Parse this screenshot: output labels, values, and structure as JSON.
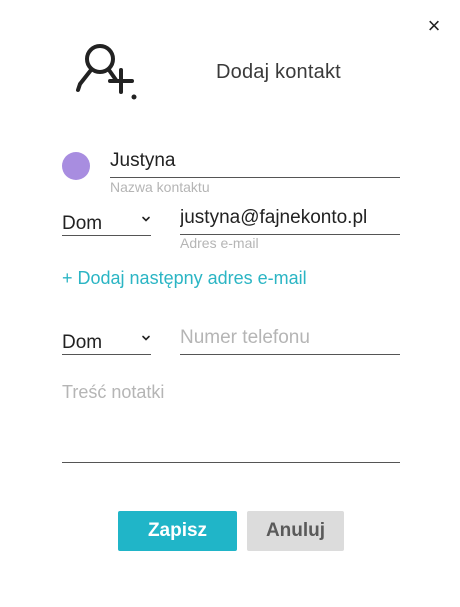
{
  "dialog": {
    "title": "Dodaj kontakt",
    "close_glyph": "×",
    "header_icon": "user-add-icon"
  },
  "contact": {
    "avatar_color": "#a88de0",
    "name_value": "Justyna",
    "name_hint": "Nazwa kontaktu"
  },
  "email": {
    "type_selected": "Dom",
    "value": "justyna@fajnekonto.pl",
    "hint": "Adres e-mail",
    "add_another_label": "+ Dodaj następny adres e-mail"
  },
  "phone": {
    "type_selected": "Dom",
    "placeholder": "Numer telefonu",
    "value": ""
  },
  "note": {
    "placeholder": "Treść notatki"
  },
  "actions": {
    "save_label": "Zapisz",
    "cancel_label": "Anuluj",
    "save_color": "#20b5c8",
    "cancel_color": "#dcdcdc"
  }
}
